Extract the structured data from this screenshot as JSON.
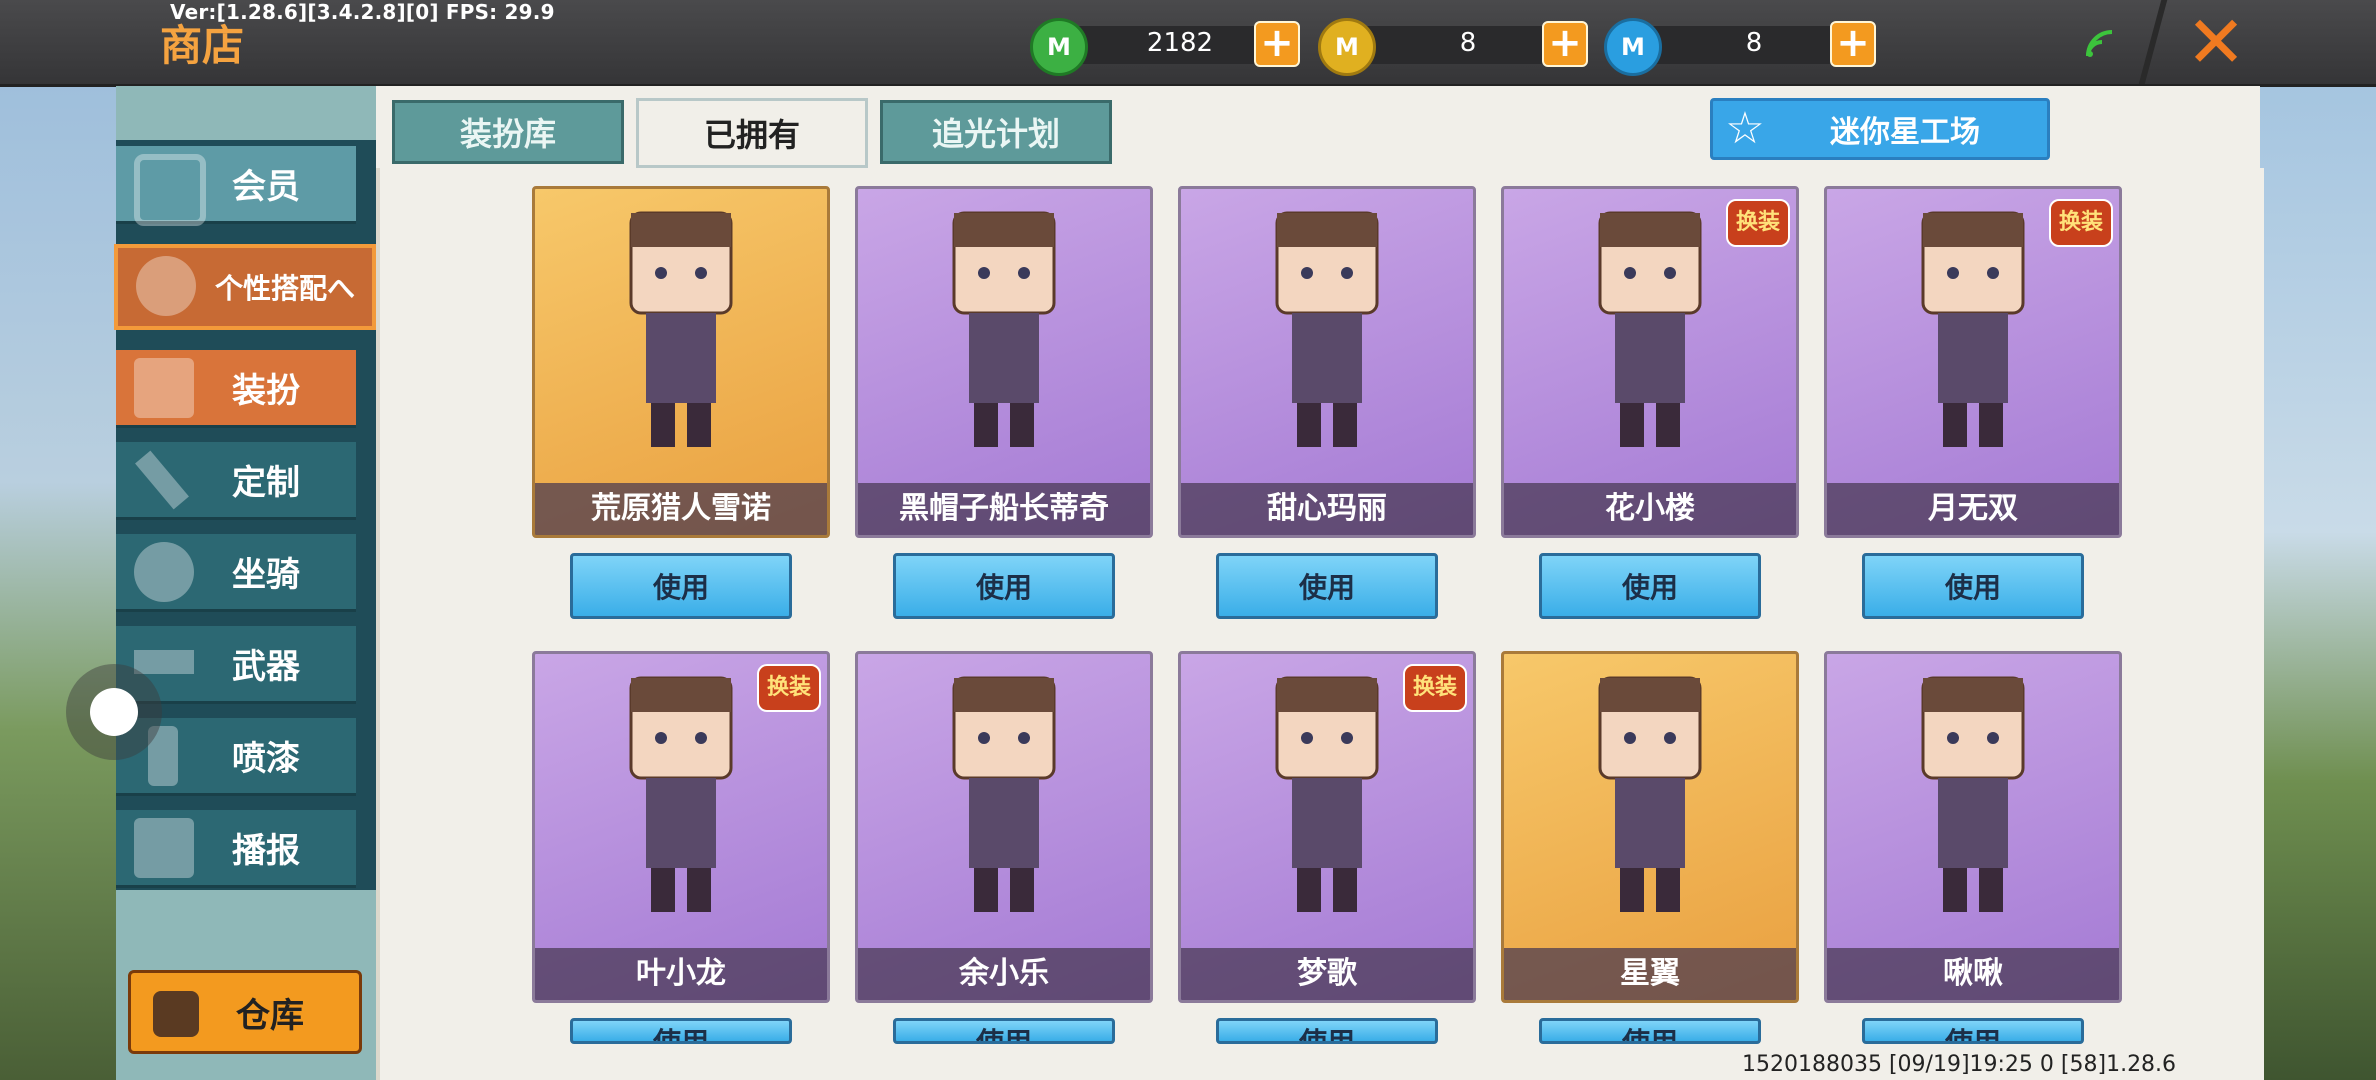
{
  "debug_text": "Ver:[1.28.6][3.4.2.8][0] FPS: 29.9",
  "header": {
    "title": "商店",
    "currencies": [
      {
        "icon": "green-mini-coin-icon",
        "color": "#3cb043",
        "value": "2182"
      },
      {
        "icon": "gold-mini-coin-icon",
        "color": "#e0b020",
        "value": "8"
      },
      {
        "icon": "blue-mini-coin-icon",
        "color": "#2a9ee0",
        "value": "8"
      }
    ]
  },
  "sidebar": {
    "member": "会员",
    "custom_outfit": "个性搭配へ",
    "items": [
      "装扮",
      "定制",
      "坐骑",
      "武器",
      "喷漆",
      "播报"
    ],
    "warehouse": "仓库"
  },
  "tabs": [
    "装扮库",
    "已拥有",
    "追光计划"
  ],
  "active_tab": "已拥有",
  "workshop_button": "迷你星工场",
  "use_label": "使用",
  "cards": [
    {
      "name": "荒原猎人雪诺",
      "style": "gold",
      "badge": false
    },
    {
      "name": "黑帽子船长蒂奇",
      "style": "purple",
      "badge": false
    },
    {
      "name": "甜心玛丽",
      "style": "purple",
      "badge": false
    },
    {
      "name": "花小楼",
      "style": "purple",
      "badge": true
    },
    {
      "name": "月无双",
      "style": "purple",
      "badge": true
    },
    {
      "name": "叶小龙",
      "style": "purple",
      "badge": true
    },
    {
      "name": "余小乐",
      "style": "purple",
      "badge": false
    },
    {
      "name": "梦歌",
      "style": "purple",
      "badge": true
    },
    {
      "name": "星翼",
      "style": "gold",
      "badge": false
    },
    {
      "name": "啾啾",
      "style": "purple",
      "badge": false
    }
  ],
  "badge_text": "换装",
  "footer_info": "1520188035   [09/19]19:25 0   [58]1.28.6"
}
